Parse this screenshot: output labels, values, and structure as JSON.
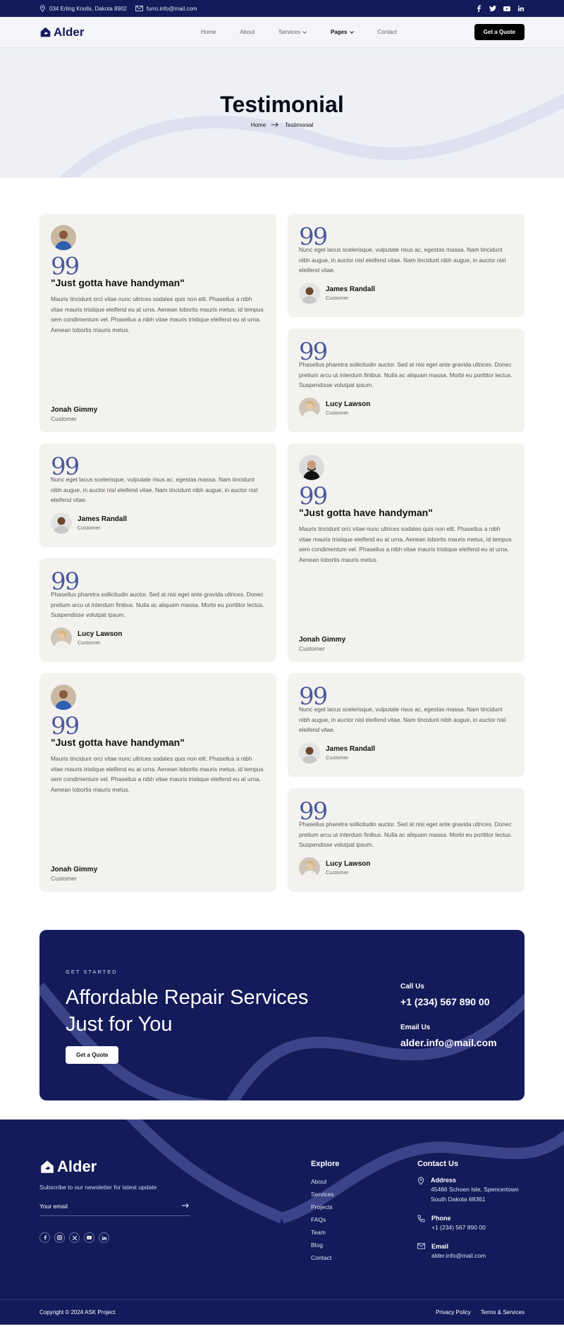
{
  "topbar": {
    "address": "034 Erling Knolls, Dakota 8902",
    "email": "furro.info@mail.com",
    "social_icons": [
      "facebook-icon",
      "twitter-icon",
      "youtube-icon",
      "linkedin-icon"
    ]
  },
  "header": {
    "brand": "Alder",
    "nav": [
      "Home",
      "About",
      "Services",
      "Pages",
      "Contact"
    ],
    "cta": "Get a Quote"
  },
  "hero": {
    "title": "Testimonial",
    "breadcrumb_home": "Home",
    "breadcrumb_current": "Testimonial"
  },
  "testimonials": {
    "big": {
      "headline": "\"Just gotta have handyman\"",
      "text": "Mauris tincidunt orci vitae nunc ultrices sodales quis non elit. Phasellus a nibh vitae mauris tristique eleifend eu at urna. Aenean lobortis mauris metus, id tempus sem condimentum vel. Phasellus a nibh vitae mauris tristique eleifend eu at urna. Aenean lobortis mauris metus.",
      "name": "Jonah Gimmy",
      "role": "Customer"
    },
    "james": {
      "text": "Nunc eget lacus scelerisque, vulputate risus ac, egestas massa. Nam tincidunt nibh augue, in auctor nisl eleifend vitae. Nam tincidunt nibh augue, in auctor nisl eleifend vitae.",
      "name": "James Randall",
      "role": "Customer"
    },
    "lucy": {
      "text": "Phasellus pharetra sollicitudin auctor. Sed at nisi eget ante gravida ultrices. Donec pretium arcu ut interdum finibus. Nulla ac aliquam massa. Morbi eu porttitor lectus. Suspendisse volutpat ipsum.",
      "name": "Lucy Lawson",
      "role": "Customer"
    },
    "quote_glyph": "99"
  },
  "cta": {
    "eyebrow": "GET STARTED",
    "title": "Affordable Repair Services Just for You",
    "button": "Get a Quote",
    "call_label": "Call Us",
    "call_value": "+1 (234) 567 890 00",
    "email_label": "Email Us",
    "email_value": "alder.info@mail.com"
  },
  "footer": {
    "brand": "Alder",
    "subscribe_text": "Subscribe to our newsletter for latest update",
    "email_placeholder": "Your email",
    "explore_title": "Explore",
    "explore_links": [
      "About",
      "Services",
      "Projects",
      "FAQs",
      "Team",
      "Blog",
      "Contact"
    ],
    "contact_title": "Contact Us",
    "address_label": "Address",
    "address_value": "45486 Schoen Isle, Spencertown South Dakota 68361",
    "phone_label": "Phone",
    "phone_value": "+1 (234) 567 890 00",
    "email_label": "Email",
    "email_value": "alder.info@mail.com",
    "copyright": "Copyright © 2024 ASK Project",
    "privacy": "Privacy Policy",
    "terms": "Terms & Services"
  },
  "colors": {
    "navy": "#141b5a",
    "cream": "#f4f2ee",
    "hero_bg": "#eef0f6"
  }
}
